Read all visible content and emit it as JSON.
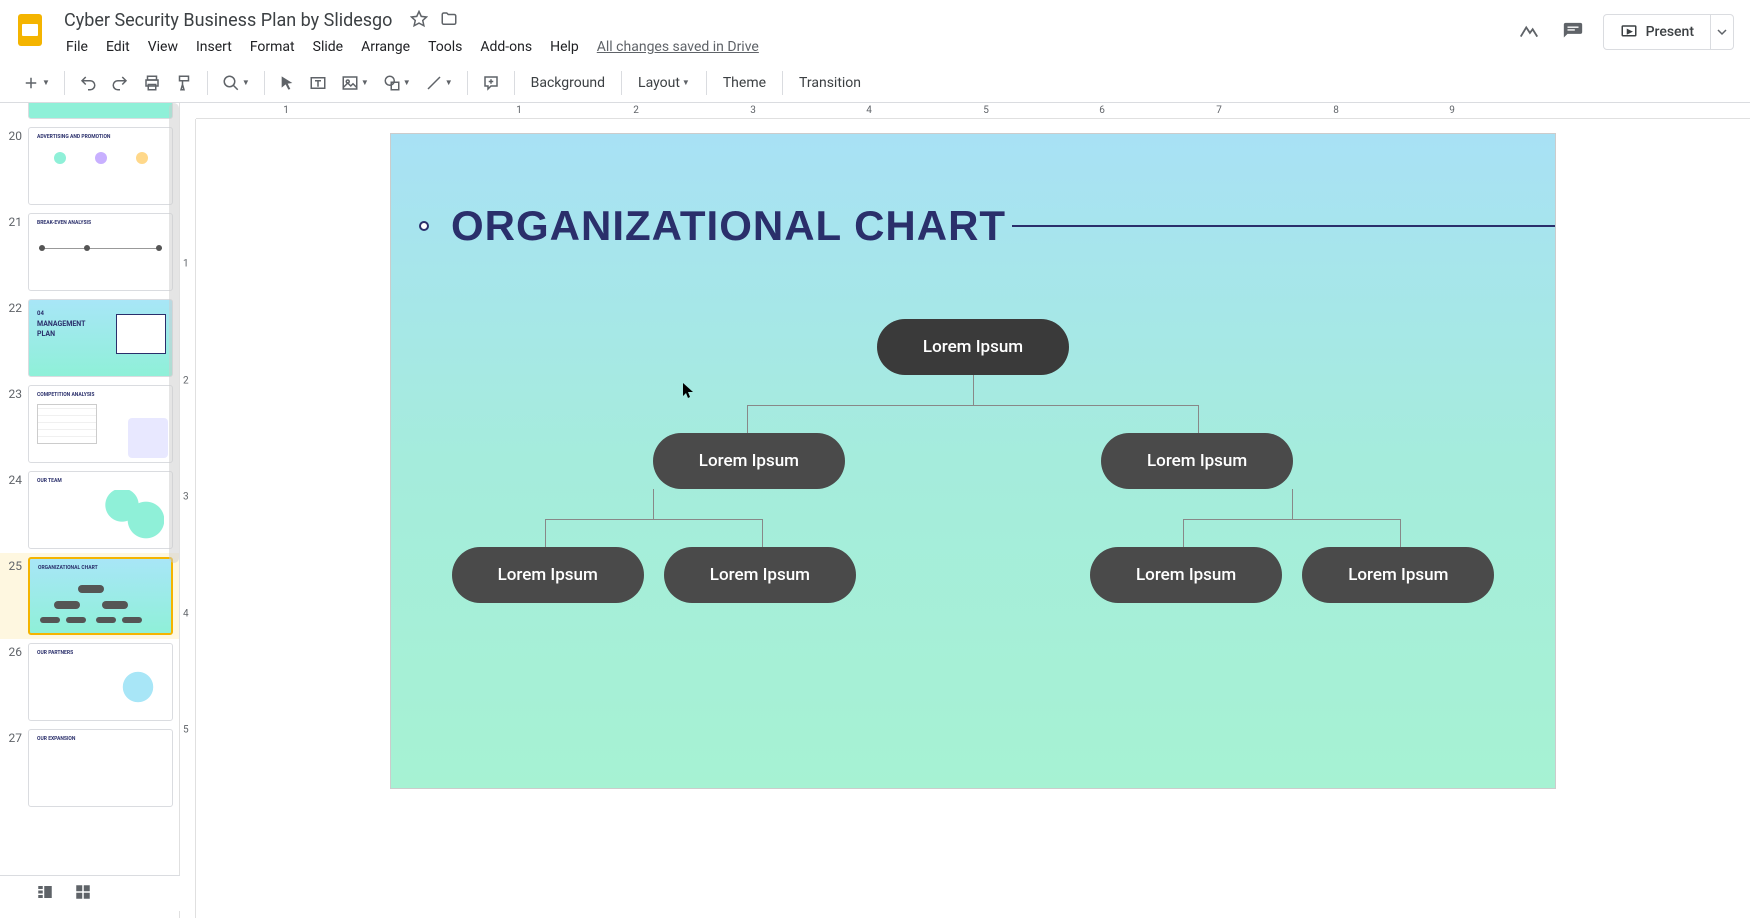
{
  "document": {
    "title": "Cyber Security Business Plan by Slidesgo",
    "save_status": "All changes saved in Drive"
  },
  "menu": {
    "file": "File",
    "edit": "Edit",
    "view": "View",
    "insert": "Insert",
    "format": "Format",
    "slide": "Slide",
    "arrange": "Arrange",
    "tools": "Tools",
    "addons": "Add-ons",
    "help": "Help"
  },
  "header_actions": {
    "present": "Present"
  },
  "toolbar": {
    "background": "Background",
    "layout": "Layout",
    "theme": "Theme",
    "transition": "Transition"
  },
  "slides": {
    "visible_numbers": [
      "20",
      "21",
      "22",
      "23",
      "24",
      "25",
      "26",
      "27"
    ],
    "selected": "25",
    "thumb_titles": {
      "t20": "ADVERTISING AND PROMOTION",
      "t21": "BREAK-EVEN ANALYSIS",
      "t22_num": "04",
      "t22_a": "MANAGEMENT",
      "t22_b": "PLAN",
      "t23": "COMPETITION ANALYSIS",
      "t24": "OUR TEAM",
      "t25": "ORGANIZATIONAL CHART",
      "t26": "OUR PARTNERS",
      "t27": "OUR EXPANSION"
    }
  },
  "ruler": {
    "h": [
      "1",
      "1",
      "2",
      "3",
      "4",
      "5",
      "6",
      "7",
      "8",
      "9"
    ],
    "v": [
      "1",
      "2",
      "3",
      "4",
      "5"
    ]
  },
  "slide_content": {
    "title": "ORGANIZATIONAL CHART",
    "nodes": {
      "top": "Lorem Ipsum",
      "l2a": "Lorem Ipsum",
      "l2b": "Lorem Ipsum",
      "l3a": "Lorem Ipsum",
      "l3b": "Lorem Ipsum",
      "l3c": "Lorem Ipsum",
      "l3d": "Lorem Ipsum"
    }
  },
  "chart_data": {
    "type": "org-chart",
    "title": "ORGANIZATIONAL CHART",
    "root": {
      "label": "Lorem Ipsum",
      "children": [
        {
          "label": "Lorem Ipsum",
          "children": [
            {
              "label": "Lorem Ipsum"
            },
            {
              "label": "Lorem Ipsum"
            }
          ]
        },
        {
          "label": "Lorem Ipsum",
          "children": [
            {
              "label": "Lorem Ipsum"
            },
            {
              "label": "Lorem Ipsum"
            }
          ]
        }
      ]
    }
  },
  "colors": {
    "accent": "#2a2f6b",
    "node": "#4a4a4a",
    "bg_top": "#a8e1f5",
    "bg_bottom": "#a6f2d3"
  }
}
